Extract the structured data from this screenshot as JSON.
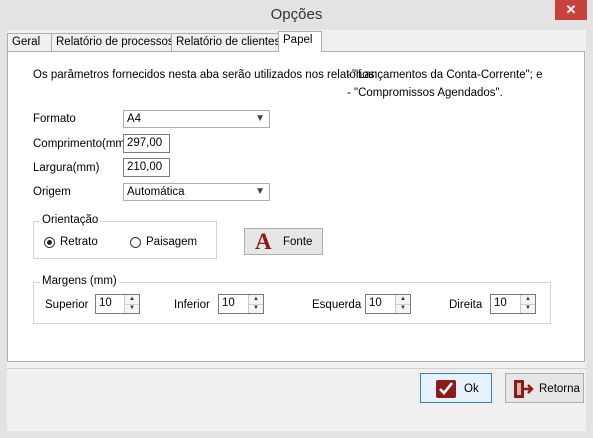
{
  "window": {
    "title": "Opções",
    "close_symbol": "✕"
  },
  "tabs": [
    {
      "label": "Geral"
    },
    {
      "label": "Relatório de processos"
    },
    {
      "label": "Relatório de clientes"
    },
    {
      "label": "Papel"
    }
  ],
  "panel": {
    "info_text": "Os parâmetros fornecidos nesta aba serão utilizados nos relatórios:",
    "report_1": "- \"Lançamentos da Conta-Corrente\"; e",
    "report_2": "- \"Compromissos Agendados\".",
    "formato": {
      "label": "Formato",
      "value": "A4"
    },
    "comprimento": {
      "label": "Comprimento(mm)",
      "value": "297,00"
    },
    "largura": {
      "label": "Largura(mm)",
      "value": "210,00"
    },
    "origem": {
      "label": "Origem",
      "value": "Automática"
    },
    "orientacao": {
      "title": "Orientação",
      "retrato": "Retrato",
      "paisagem": "Paisagem",
      "selected": "Retrato"
    },
    "fonte_button": {
      "label": "Fonte",
      "glyph": "A"
    },
    "margens": {
      "title": "Margens (mm)",
      "superior": {
        "label": "Superior",
        "value": "10"
      },
      "inferior": {
        "label": "Inferior",
        "value": "10"
      },
      "esquerda": {
        "label": "Esquerda",
        "value": "10"
      },
      "direita": {
        "label": "Direita",
        "value": "10"
      }
    }
  },
  "footer": {
    "ok_label": "Ok",
    "retorna_label": "Retorna"
  },
  "colors": {
    "accent_red": "#8b1a1a",
    "close_red": "#c8423d",
    "default_button_border": "#3c7fb1"
  },
  "icons": {
    "ok": "checkmark-icon",
    "retorna": "exit-door-icon",
    "fonte": "font-letter-a-icon"
  }
}
